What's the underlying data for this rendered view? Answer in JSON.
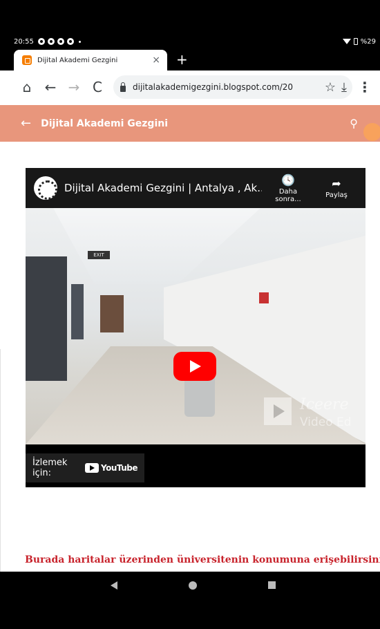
{
  "status_bar": {
    "time": "20:55",
    "battery": "%29"
  },
  "browser": {
    "tab_title": "Dijital Akademi Gezgini",
    "tab_close": "×",
    "new_tab": "+",
    "home": "⌂",
    "back": "←",
    "forward": "→",
    "reload": "C",
    "url": "dijitalakademigezgini.blogspot.com/20",
    "bookmark": "☆",
    "download": "⤓",
    "menu": "⋮"
  },
  "blog_header": {
    "back": "←",
    "title": "Dijital Akademi Gezgini",
    "search": "⚲"
  },
  "video": {
    "title": "Dijital Akademi Gezgini | Antalya , Ak...",
    "watch_later_label": "Daha sonra...",
    "share_label": "Paylaş",
    "watch_on": "İzlemek için:",
    "youtube": "YouTube",
    "watermark_line1": "Iceere",
    "watermark_line2": "Video Ed",
    "exit_sign": "EXIT"
  },
  "post": {
    "link_text": "Burada haritalar üzerinden üniversitenin konumuna erişebilirsiniz"
  },
  "colors": {
    "header": "#e8967c",
    "accent_red": "#c8232c",
    "yt_red": "#ff0000"
  }
}
